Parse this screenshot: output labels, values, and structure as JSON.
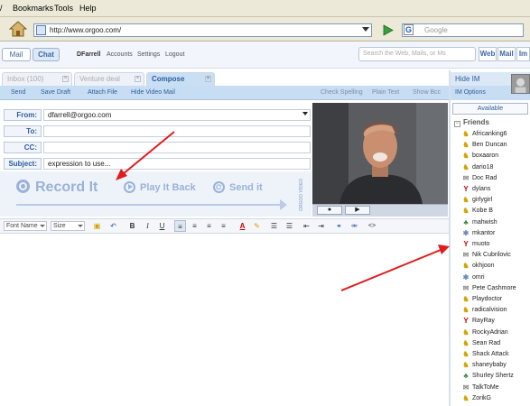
{
  "menu": {
    "cut": "/",
    "bookmarks": "Bookmarks",
    "tools": "Tools",
    "help": "Help"
  },
  "address": {
    "url": "http://www.orgoo.com/",
    "search_placeholder": "Google",
    "search_engine_letter": "G"
  },
  "app": {
    "mail_tab": "Mail",
    "chat_tab": "Chat",
    "user": "DFarrell",
    "accounts": "Accounts",
    "settings": "Settings",
    "logout": "Logout",
    "search_placeholder": "Search the Web, Mails, or Ms",
    "search_web": "Web",
    "search_mail": "Mail",
    "search_im": "Im"
  },
  "folders": {
    "inbox": "Inbox (100)",
    "venture": "Venture deal",
    "compose": "Compose",
    "close_glyph": "×"
  },
  "actions": {
    "send": "Send",
    "save_draft": "Save Draft",
    "attach_file": "Attach File",
    "hide_video": "Hide Video Mail",
    "check_spelling": "Check Spelling",
    "plain_text": "Plain Text",
    "show_bcc": "Show Bcc"
  },
  "compose": {
    "from_label": "From:",
    "from_value": "dfarrell@orgoo.com",
    "to_label": "To:",
    "to_value": "",
    "cc_label": "CC:",
    "cc_value": "",
    "subject_label": "Subject:",
    "subject_value": "expression to use..."
  },
  "video_mail": {
    "record": "Record It",
    "play": "Play It Back",
    "send": "Send it",
    "brand": "ORGOO VIDEO",
    "stop_glyph": "●",
    "play_glyph": "▶"
  },
  "format": {
    "font_name": "Font Name",
    "size": "Size",
    "buttons": [
      "B",
      "I",
      "U",
      "A",
      "<>"
    ]
  },
  "im": {
    "hide": "Hide IM",
    "options": "IM Options",
    "status": "Available",
    "friends_header": "Friends",
    "collapse_glyph": "−",
    "friends": [
      {
        "name": "Africanking6",
        "svc": "aim"
      },
      {
        "name": "Ben Duncan",
        "svc": "aim"
      },
      {
        "name": "boxaaron",
        "svc": "aim"
      },
      {
        "name": "dario18",
        "svc": "aim"
      },
      {
        "name": "Doc Rad",
        "svc": "gt"
      },
      {
        "name": "dylans",
        "svc": "yh"
      },
      {
        "name": "girlygirl",
        "svc": "aim"
      },
      {
        "name": "Kobe B",
        "svc": "aim"
      },
      {
        "name": "mahwish",
        "svc": "msn"
      },
      {
        "name": "mkantor",
        "svc": "mix"
      },
      {
        "name": "muoto",
        "svc": "yh"
      },
      {
        "name": "Nik Cubrilovic",
        "svc": "gt"
      },
      {
        "name": "okhjoon",
        "svc": "aim"
      },
      {
        "name": "omri",
        "svc": "mix"
      },
      {
        "name": "Pete Cashmore",
        "svc": "gt"
      },
      {
        "name": "Playdoctor",
        "svc": "aim"
      },
      {
        "name": "radicalvision",
        "svc": "aim"
      },
      {
        "name": "RayRay",
        "svc": "yh"
      },
      {
        "name": "RockyAdrian",
        "svc": "aim"
      },
      {
        "name": "Sean Rad",
        "svc": "aim"
      },
      {
        "name": "Shack Attack",
        "svc": "aim"
      },
      {
        "name": "shaneybaby",
        "svc": "aim"
      },
      {
        "name": "Shurley Shertz",
        "svc": "msn"
      },
      {
        "name": "TalkToMe",
        "svc": "gt"
      },
      {
        "name": "ZorikG",
        "svc": "aim"
      }
    ]
  },
  "annotation_color": "#e01c1c"
}
